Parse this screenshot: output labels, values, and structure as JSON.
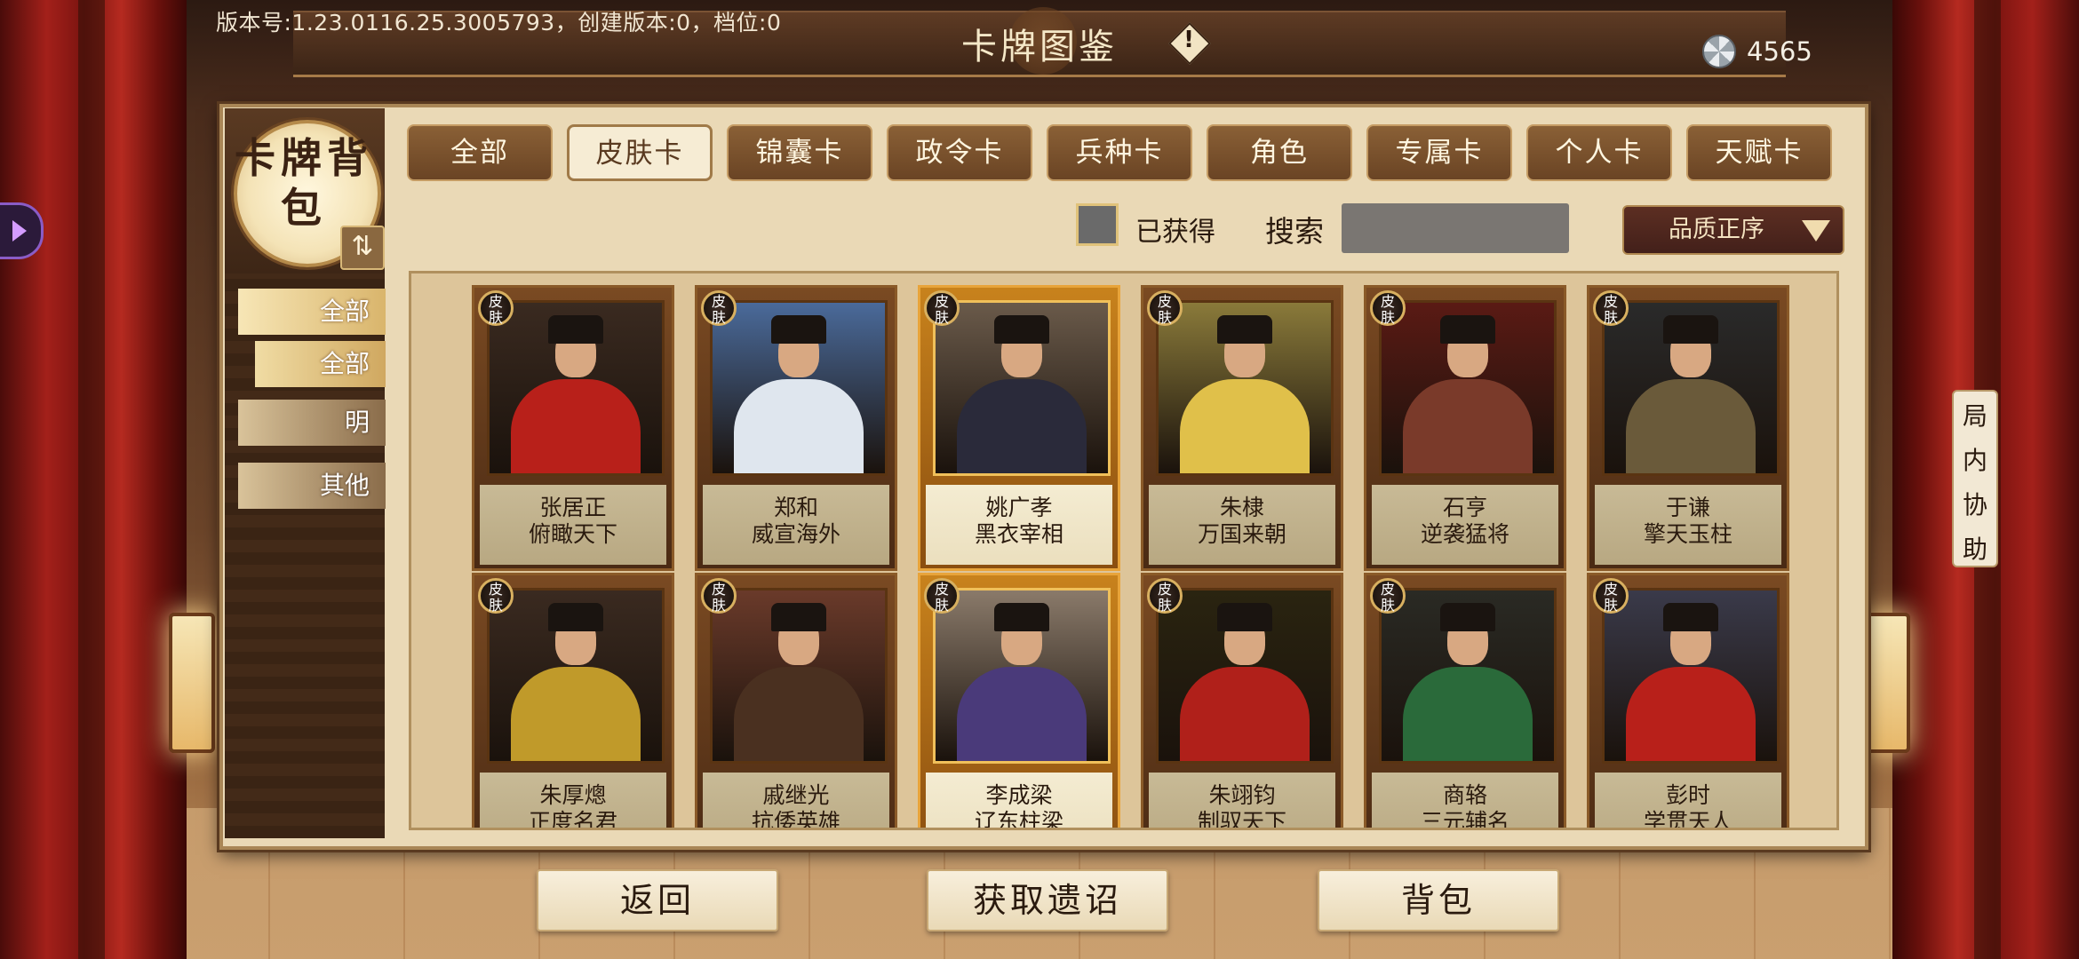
{
  "header": {
    "version": "版本号:1.23.0116.25.3005793，创建版本:0，档位:0",
    "title": "卡牌图鉴",
    "info_icon_text": "!",
    "currency_icon": "silver-fan-coin-icon",
    "currency_value": "4565"
  },
  "sidebar": {
    "badge_text": "卡牌背包",
    "swap_icon": "swap-icon",
    "items": [
      {
        "label": "全部",
        "state": "active"
      },
      {
        "label": "全部",
        "state": "sub"
      },
      {
        "label": "明",
        "state": "inactive"
      },
      {
        "label": "其他",
        "state": "inactive"
      }
    ]
  },
  "tabs": [
    {
      "label": "全部",
      "selected": false
    },
    {
      "label": "皮肤卡",
      "selected": true
    },
    {
      "label": "锦囊卡",
      "selected": false
    },
    {
      "label": "政令卡",
      "selected": false
    },
    {
      "label": "兵种卡",
      "selected": false
    },
    {
      "label": "角色",
      "selected": false
    },
    {
      "label": "专属卡",
      "selected": false
    },
    {
      "label": "个人卡",
      "selected": false
    },
    {
      "label": "天赋卡",
      "selected": false
    }
  ],
  "filters": {
    "owned_label": "已获得",
    "owned_checked": false,
    "search_label": "搜索",
    "search_value": "",
    "sort_label": "品质正序"
  },
  "cards": [
    {
      "badge": "皮肤",
      "name": "张居正",
      "subtitle": "俯瞰天下",
      "gold": false,
      "palette": [
        "#3a2a20",
        "#b8201a"
      ]
    },
    {
      "badge": "皮肤",
      "name": "郑和",
      "subtitle": "威宣海外",
      "gold": false,
      "palette": [
        "#4a6a9a",
        "#dfe6ee"
      ]
    },
    {
      "badge": "皮肤",
      "name": "姚广孝",
      "subtitle": "黑衣宰相",
      "gold": true,
      "palette": [
        "#6a5a4a",
        "#2a2a3a"
      ]
    },
    {
      "badge": "皮肤",
      "name": "朱棣",
      "subtitle": "万国来朝",
      "gold": false,
      "palette": [
        "#8a7a3a",
        "#e0c04a"
      ]
    },
    {
      "badge": "皮肤",
      "name": "石亨",
      "subtitle": "逆袭猛将",
      "gold": false,
      "palette": [
        "#5a1a14",
        "#7a3a2a"
      ]
    },
    {
      "badge": "皮肤",
      "name": "于谦",
      "subtitle": "擎天玉柱",
      "gold": false,
      "palette": [
        "#2a2a2a",
        "#6a5a3a"
      ]
    },
    {
      "badge": "皮肤",
      "name": "朱厚熜",
      "subtitle": "正度名君",
      "gold": false,
      "palette": [
        "#3a2a20",
        "#c09a2a"
      ]
    },
    {
      "badge": "皮肤",
      "name": "戚继光",
      "subtitle": "抗倭英雄",
      "gold": false,
      "palette": [
        "#6a3a2a",
        "#4a3020"
      ]
    },
    {
      "badge": "皮肤",
      "name": "李成梁",
      "subtitle": "辽东柱梁",
      "gold": true,
      "palette": [
        "#8a7a6a",
        "#4a3a7a"
      ]
    },
    {
      "badge": "皮肤",
      "name": "朱翊钧",
      "subtitle": "制驭天下",
      "gold": false,
      "palette": [
        "#2a2410",
        "#b0201a"
      ]
    },
    {
      "badge": "皮肤",
      "name": "商辂",
      "subtitle": "三元辅名",
      "gold": false,
      "palette": [
        "#2a2a24",
        "#2a6a3a"
      ]
    },
    {
      "badge": "皮肤",
      "name": "彭时",
      "subtitle": "学贯天人",
      "gold": false,
      "palette": [
        "#3a3a4a",
        "#b8201a"
      ]
    }
  ],
  "help_tab": [
    "局",
    "内",
    "协",
    "助"
  ],
  "bottom_buttons": [
    {
      "label": "返回"
    },
    {
      "label": "获取遗诏"
    },
    {
      "label": "背包"
    }
  ]
}
